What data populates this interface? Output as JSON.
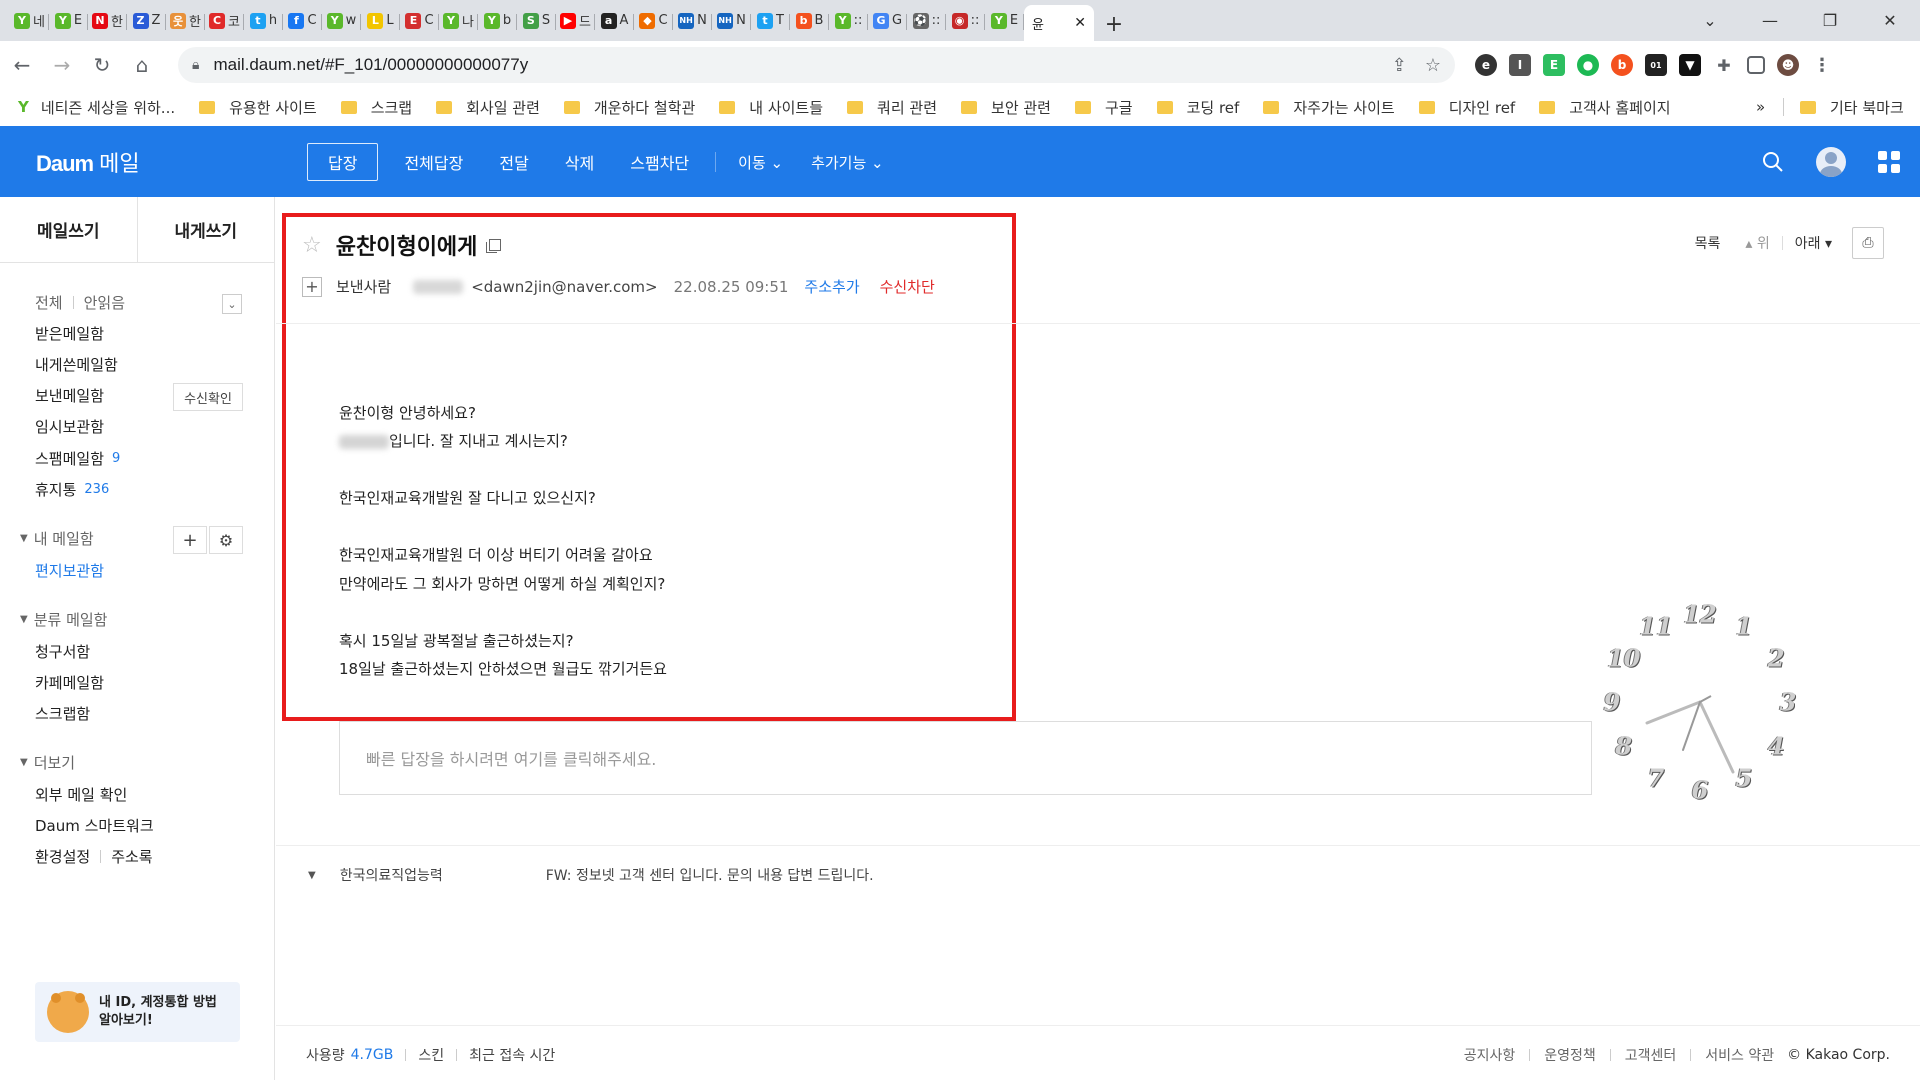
{
  "browser": {
    "tabs": [
      {
        "icon": "naver-sprout-icon",
        "letter": "Y",
        "color": "#5ab82b",
        "text": "네"
      },
      {
        "icon": "naver-sprout-icon",
        "letter": "Y",
        "color": "#5ab82b",
        "text": "E"
      },
      {
        "icon": "netflix-icon",
        "letter": "N",
        "color": "#e50914",
        "text": "한"
      },
      {
        "icon": "z-icon",
        "letter": "Z",
        "color": "#2a5bd7",
        "text": "Z"
      },
      {
        "icon": "person-icon",
        "letter": "웃",
        "color": "#e8913a",
        "text": "한"
      },
      {
        "icon": "c-icon",
        "letter": "C",
        "color": "#e02a2a",
        "text": "코"
      },
      {
        "icon": "twitter-icon",
        "letter": "t",
        "color": "#1da1f2",
        "text": "h"
      },
      {
        "icon": "facebook-icon",
        "letter": "f",
        "color": "#1877f2",
        "text": "C"
      },
      {
        "icon": "naver-sprout-icon",
        "letter": "Y",
        "color": "#5ab82b",
        "text": "w"
      },
      {
        "icon": "yellow-icon",
        "letter": "L",
        "color": "#f2c500",
        "text": "L"
      },
      {
        "icon": "red-icon",
        "letter": "E",
        "color": "#d32f2f",
        "text": "C"
      },
      {
        "icon": "naver-sprout-icon",
        "letter": "Y",
        "color": "#5ab82b",
        "text": "나"
      },
      {
        "icon": "naver-sprout-icon",
        "letter": "Y",
        "color": "#5ab82b",
        "text": "b"
      },
      {
        "icon": "s-icon",
        "letter": "S",
        "color": "#43a047",
        "text": "S"
      },
      {
        "icon": "youtube-icon",
        "letter": "▶",
        "color": "#ff0000",
        "text": "드"
      },
      {
        "icon": "amazon-icon",
        "letter": "a",
        "color": "#222222",
        "text": "A"
      },
      {
        "icon": "box-icon",
        "letter": "◆",
        "color": "#ef6c00",
        "text": "C"
      },
      {
        "icon": "nh-icon",
        "letter": "NH",
        "color": "#1565c0",
        "text": "N"
      },
      {
        "icon": "nh-icon",
        "letter": "NH",
        "color": "#1565c0",
        "text": "N"
      },
      {
        "icon": "twitter-icon",
        "letter": "t",
        "color": "#1da1f2",
        "text": "T"
      },
      {
        "icon": "b-icon",
        "letter": "b",
        "color": "#f4511e",
        "text": "B"
      },
      {
        "icon": "naver-sprout-icon",
        "letter": "Y",
        "color": "#5ab82b",
        "text": "::"
      },
      {
        "icon": "google-icon",
        "letter": "G",
        "color": "#4285f4",
        "text": "G"
      },
      {
        "icon": "soccer-icon",
        "letter": "⚽",
        "color": "#666666",
        "text": "::"
      },
      {
        "icon": "emblem-icon",
        "letter": "◉",
        "color": "#c62828",
        "text": "::"
      },
      {
        "icon": "naver-sprout-icon",
        "letter": "Y",
        "color": "#5ab82b",
        "text": "E"
      }
    ],
    "active_tab": {
      "text": "윤",
      "close": "✕"
    },
    "new_tab": "+",
    "window_controls": {
      "collapse": "⌄",
      "minimize": "—",
      "restore": "❐",
      "close": "✕"
    },
    "url": "mail.daum.net/#F_101/00000000000077y",
    "bookmarks": [
      {
        "label": "네티즌 세상을 위하...",
        "type": "sprout"
      },
      {
        "label": "유용한 사이트",
        "type": "folder"
      },
      {
        "label": "스크랩",
        "type": "folder"
      },
      {
        "label": "회사일 관련",
        "type": "folder"
      },
      {
        "label": "개운하다 철학관",
        "type": "folder"
      },
      {
        "label": "내 사이트들",
        "type": "folder"
      },
      {
        "label": "쿼리 관련",
        "type": "folder"
      },
      {
        "label": "보안 관련",
        "type": "folder"
      },
      {
        "label": "구글",
        "type": "folder"
      },
      {
        "label": "코딩 ref",
        "type": "folder"
      },
      {
        "label": "자주가는 사이트",
        "type": "folder"
      },
      {
        "label": "디자인 ref",
        "type": "folder"
      },
      {
        "label": "고객사 홈페이지",
        "type": "folder"
      }
    ],
    "bookmarks_more": "»",
    "other_bookmarks": "기타 북마크"
  },
  "header": {
    "logo_daum": "Daum",
    "logo_mail": "메일",
    "actions": {
      "reply": "답장",
      "reply_all": "전체답장",
      "forward": "전달",
      "delete": "삭제",
      "spam_block": "스팸차단",
      "move": "이동 ⌄",
      "more": "추가기능 ⌄"
    }
  },
  "sidebar": {
    "compose": "메일쓰기",
    "to_me": "내게쓰기",
    "filter_all": "전체",
    "filter_unread": "안읽음",
    "folders": [
      {
        "label": "받은메일함",
        "count": ""
      },
      {
        "label": "내게쓴메일함",
        "count": ""
      },
      {
        "label": "보낸메일함",
        "count": ""
      },
      {
        "label": "임시보관함",
        "count": ""
      },
      {
        "label": "스팸메일함",
        "count": "9"
      },
      {
        "label": "휴지통",
        "count": "236"
      }
    ],
    "read_receipt": "수신확인",
    "my_folders_title": "내 메일함",
    "my_folders": [
      "편지보관함"
    ],
    "category_title": "분류 메일함",
    "categories": [
      "청구서함",
      "카페메일함",
      "스크랩함"
    ],
    "more_title": "더보기",
    "more_items": [
      "외부 메일 확인",
      "Daum 스마트워크",
      "환경설정",
      "주소록"
    ],
    "banner": "내 ID, 계정통합 방법 알아보기!"
  },
  "message": {
    "subject": "윤찬이형이에게",
    "list_label": "목록",
    "up_label": "▴ 위",
    "down_label": "아래 ▾",
    "sender_label": "보낸사람",
    "sender_email": "<dawn2jin@naver.com>",
    "date": "22.08.25 09:51",
    "add_contact": "주소추가",
    "block_sender": "수신차단",
    "body": {
      "line1": "윤찬이형 안녕하세요?",
      "line2_suffix": "입니다. 잘 지내고 계시는지?",
      "line3": "한국인재교육개발원 잘 다니고 있으신지?",
      "line4": "한국인재교육개발원 더 이상 버티기 어려울 갈아요",
      "line5": "만약에라도 그 회사가 망하면 어떻게 하실 계획인지?",
      "line6": "혹시 15일날 광복절날 출근하셨는지?",
      "line7": "18일날 출근하셨는지 안하셨으면 월급도 깎기거든요"
    },
    "quick_reply_placeholder": "빠른 답장을 하시려면 여기를 클릭해주세요.",
    "thread": {
      "from": "한국의료직업능력",
      "subject": "FW: 정보넷 고객 센터 입니다. 문의 내용 답변 드립니다."
    }
  },
  "footer": {
    "usage_label": "사용량",
    "usage_value": "4.7GB",
    "skin": "스킨",
    "last_login": "최근 접속 시간",
    "links": [
      "공지사항",
      "운영정책",
      "고객센터",
      "서비스 약관"
    ],
    "copyright": "© Kakao Corp."
  },
  "clock": {
    "numbers": [
      "12",
      "1",
      "2",
      "3",
      "4",
      "5",
      "6",
      "7",
      "8",
      "9",
      "10",
      "11"
    ]
  },
  "colors": {
    "brand_blue": "#1f7ae8",
    "highlight_red": "#e81c1c",
    "block_red": "#e02a2a"
  }
}
